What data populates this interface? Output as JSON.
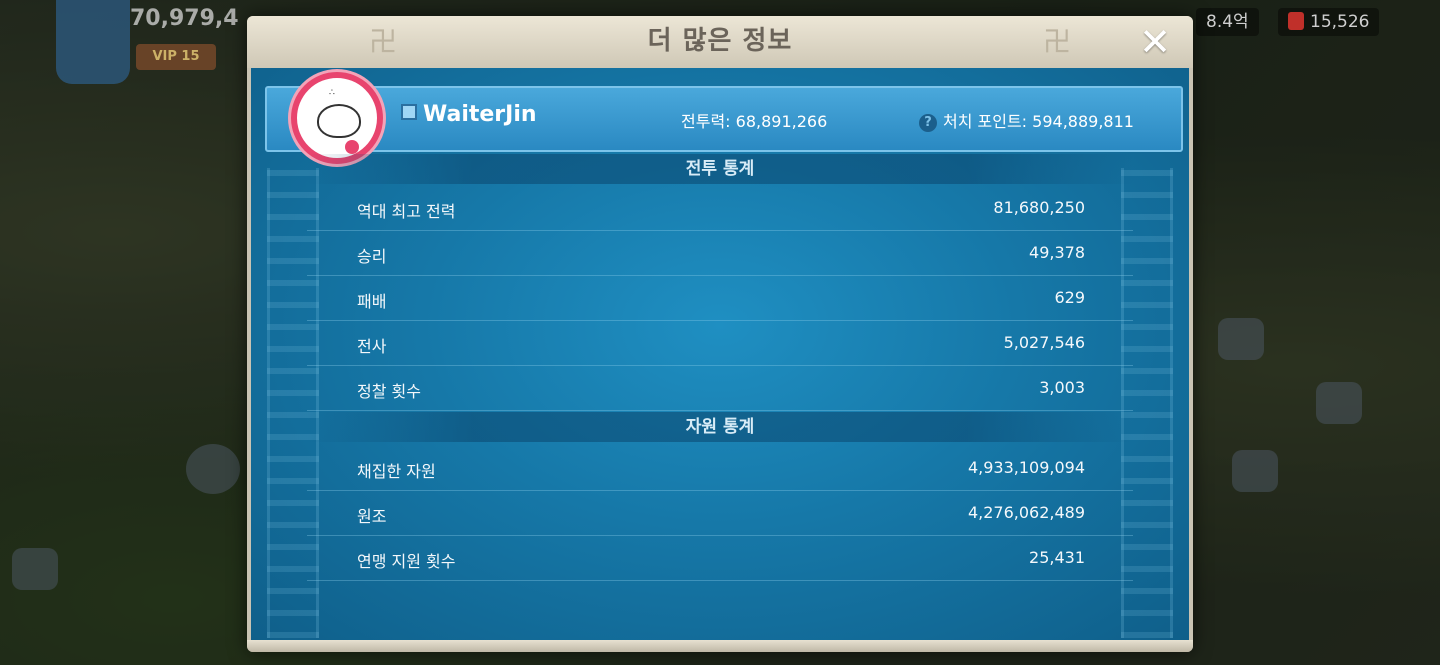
{
  "hud": {
    "power": "70,979,4",
    "vip": "VIP 15",
    "resource_a": "8.4억",
    "resource_b": "15,526"
  },
  "modal": {
    "title": "더 많은 정보",
    "close_symbol": "✕"
  },
  "profile": {
    "name": "WaiterJin",
    "power_label": "전투력:",
    "power_value": "68,891,266",
    "kill_label": "처치 포인트:",
    "kill_value": "594,889,811",
    "help_symbol": "?"
  },
  "battle_stats": {
    "header": "전투 통계",
    "rows": [
      {
        "label": "역대 최고 전력",
        "value": "81,680,250"
      },
      {
        "label": "승리",
        "value": "49,378"
      },
      {
        "label": "패배",
        "value": "629"
      },
      {
        "label": "전사",
        "value": "5,027,546"
      },
      {
        "label": "정찰 횟수",
        "value": "3,003"
      }
    ]
  },
  "resource_stats": {
    "header": "자원 통계",
    "rows": [
      {
        "label": "채집한 자원",
        "value": "4,933,109,094"
      },
      {
        "label": "원조",
        "value": "4,276,062,489"
      },
      {
        "label": "연맹 지원 횟수",
        "value": "25,431"
      }
    ]
  },
  "colors": {
    "panel_blue": "#1678a8",
    "header_blue": "#2a89c2",
    "title_beige": "#ece6d6",
    "avatar_pink": "#e8446e"
  }
}
